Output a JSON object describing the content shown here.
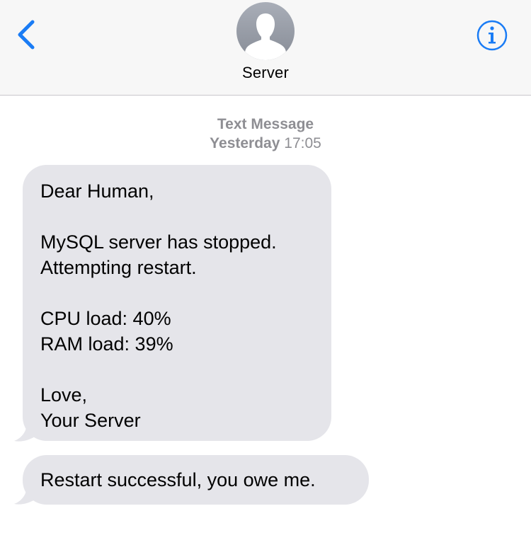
{
  "header": {
    "contact_name": "Server",
    "back_icon": "chevron-left-icon",
    "info_icon": "info-circle-icon",
    "avatar_icon": "person-silhouette-icon",
    "accent_color": "#1a7cf5"
  },
  "conversation": {
    "service_label": "Text Message",
    "day_label": "Yesterday",
    "time_label": "17:05",
    "messages": [
      {
        "lines": [
          "Dear Human,",
          "",
          "MySQL server has stopped.",
          "Attempting restart.",
          "",
          "CPU load: 40%",
          "RAM load: 39%",
          "",
          "Love,",
          "Your Server"
        ]
      },
      {
        "lines": [
          "Restart successful, you owe me."
        ]
      }
    ],
    "bubble_color": "#e5e5ea"
  }
}
